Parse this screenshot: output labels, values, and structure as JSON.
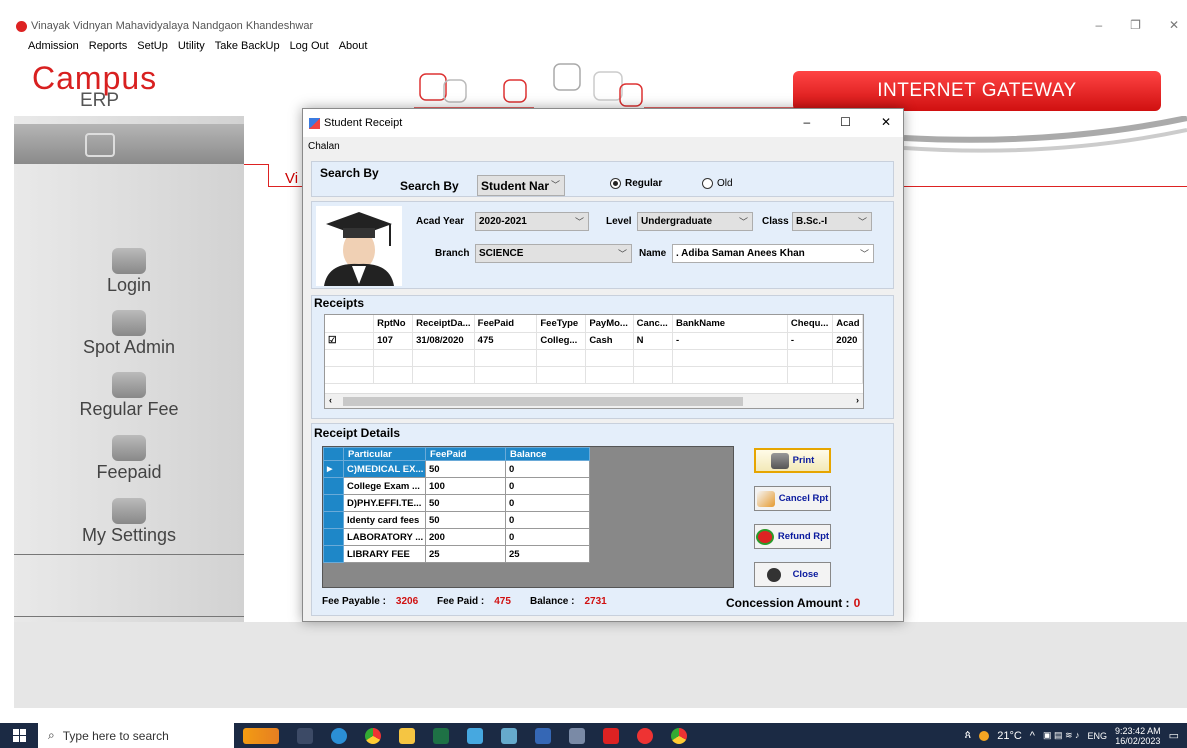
{
  "window": {
    "title": "Vinayak Vidnyan Mahavidyalaya Nandgaon Khandeshwar",
    "min": "–",
    "max": "❐",
    "close": "✕"
  },
  "menu": [
    "Admission",
    "Reports",
    "SetUp",
    "Utility",
    "Take BackUp",
    "Log Out",
    "About"
  ],
  "brand": {
    "campus": "Campus",
    "erp": "ERP",
    "gateway": "INTERNET GATEWAY",
    "partial_text": "Vi"
  },
  "nav": [
    {
      "label": "Login",
      "icon": "key-icon"
    },
    {
      "label": "Spot Admin",
      "icon": "admin-icon"
    },
    {
      "label": "Regular Fee",
      "icon": "fee-icon"
    },
    {
      "label": "Feepaid",
      "icon": "feepaid-icon"
    },
    {
      "label": "My Settings",
      "icon": "settings-icon"
    }
  ],
  "dialog": {
    "title": "Student Receipt",
    "menu": "Chalan",
    "search": {
      "group_label": "Search By",
      "field_label": "Search By",
      "field_value": "Student Nar",
      "radio_regular": "Regular",
      "radio_old": "Old",
      "selected": "Regular"
    },
    "student": {
      "acad_year_label": "Acad Year",
      "acad_year": "2020-2021",
      "level_label": "Level",
      "level": "Undergraduate",
      "class_label": "Class",
      "class": "B.Sc.-I",
      "branch_label": "Branch",
      "branch": "SCIENCE",
      "name_label": "Name",
      "name": ". Adiba Saman Anees Khan"
    },
    "receipts": {
      "label": "Receipts",
      "columns": [
        "",
        "RptNo",
        "ReceiptDa...",
        "FeePaid",
        "FeeType",
        "PayMo...",
        "Canc...",
        "BankName",
        "Chequ...",
        "Acad"
      ],
      "rows": [
        [
          "☑",
          "107",
          "31/08/2020",
          "475",
          "Colleg...",
          "Cash",
          "N",
          "-",
          "-",
          "2020"
        ]
      ]
    },
    "details": {
      "label": "Receipt Details",
      "columns": [
        "Particular",
        "FeePaid",
        "Balance"
      ],
      "rows": [
        [
          "C)MEDICAL EX...",
          "50",
          "0"
        ],
        [
          "College Exam ...",
          "100",
          "0"
        ],
        [
          "D)PHY.EFFI.TE...",
          "50",
          "0"
        ],
        [
          "Identy card fees",
          "50",
          "0"
        ],
        [
          "LABORATORY ...",
          "200",
          "0"
        ],
        [
          "LIBRARY FEE",
          "25",
          "25"
        ]
      ]
    },
    "buttons": {
      "print": "Print",
      "cancel": "Cancel Rpt",
      "refund": "Refund Rpt",
      "close": "Close"
    },
    "summary": {
      "fee_payable_label": "Fee Payable :",
      "fee_payable": "3206",
      "fee_paid_label": "Fee Paid :",
      "fee_paid": "475",
      "balance_label": "Balance :",
      "balance": "2731",
      "concession_label": "Concession Amount :",
      "concession": "0"
    }
  },
  "taskbar": {
    "search_placeholder": "Type here to search",
    "weather": "21°C",
    "lang": "ENG",
    "time": "9:23:42 AM",
    "date": "16/02/2023"
  }
}
